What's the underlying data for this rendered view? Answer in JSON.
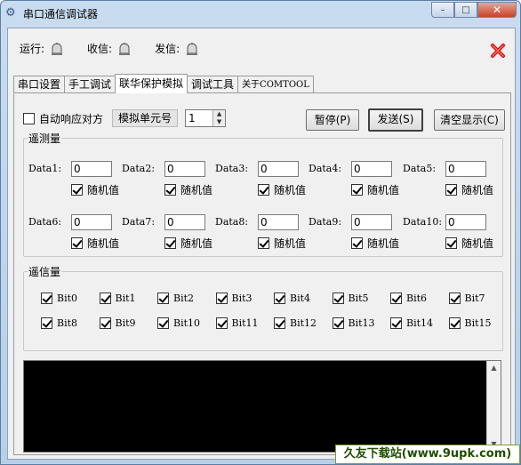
{
  "window": {
    "title": "串口通信调试器",
    "minimize": "–",
    "maximize": "□",
    "close": "✕"
  },
  "status": {
    "run_label": "运行:",
    "recv_label": "收信:",
    "send_label": "发信:"
  },
  "tabs": [
    "串口设置",
    "手工调试",
    "联华保护模拟",
    "调试工具",
    "关于COMTOOL"
  ],
  "active_tab": 2,
  "controls": {
    "auto_respond_label": "自动响应对方",
    "auto_respond_checked": false,
    "unit_label": "模拟单元号",
    "unit_value": "1",
    "pause_button": "暂停(P)",
    "send_button": "发送(S)",
    "clear_button": "清空显示(C)"
  },
  "telemetry": {
    "legend": "遥测量",
    "random_label": "随机值",
    "items": [
      {
        "label": "Data1:",
        "value": "0"
      },
      {
        "label": "Data2:",
        "value": "0"
      },
      {
        "label": "Data3:",
        "value": "0"
      },
      {
        "label": "Data4:",
        "value": "0"
      },
      {
        "label": "Data5:",
        "value": "0"
      },
      {
        "label": "Data6:",
        "value": "0"
      },
      {
        "label": "Data7:",
        "value": "0"
      },
      {
        "label": "Data8:",
        "value": "0"
      },
      {
        "label": "Data9:",
        "value": "0"
      },
      {
        "label": "Data10:",
        "value": "0"
      }
    ]
  },
  "telesignal": {
    "legend": "遥信量",
    "bits": [
      "Bit0",
      "Bit1",
      "Bit2",
      "Bit3",
      "Bit4",
      "Bit5",
      "Bit6",
      "Bit7",
      "Bit8",
      "Bit9",
      "Bit10",
      "Bit11",
      "Bit12",
      "Bit13",
      "Bit14",
      "Bit15"
    ]
  },
  "watermark": "久友下载站(www.9upk.com)"
}
